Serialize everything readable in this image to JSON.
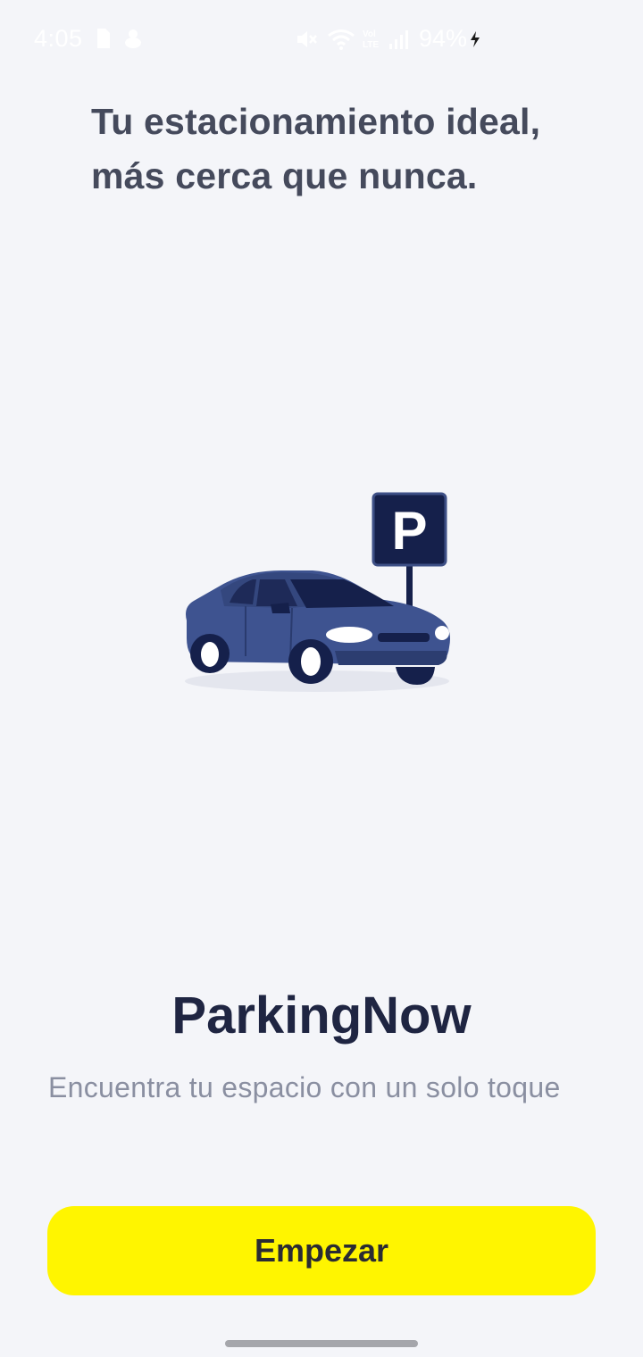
{
  "status_bar": {
    "time": "4:05",
    "battery_percent": "94%",
    "icons": [
      "sim-card-icon",
      "notification-icon",
      "mute-icon",
      "wifi-icon",
      "volte-icon",
      "signal-icon",
      "charging-icon"
    ]
  },
  "onboarding": {
    "headline_line1": "Tu estacionamiento ideal,",
    "headline_line2": "más cerca que nunca.",
    "parking_sign_letter": "P",
    "app_name": "ParkingNow",
    "tagline": "Encuentra tu espacio con un solo toque",
    "start_button_label": "Empezar"
  },
  "colors": {
    "background": "#f4f5f9",
    "accent_button": "#fff500",
    "car_body": "#3e5390",
    "sign_background": "#15204b",
    "headline_text": "#454a5c",
    "title_text": "#1f2542",
    "tagline_text": "#8a8fa1"
  }
}
